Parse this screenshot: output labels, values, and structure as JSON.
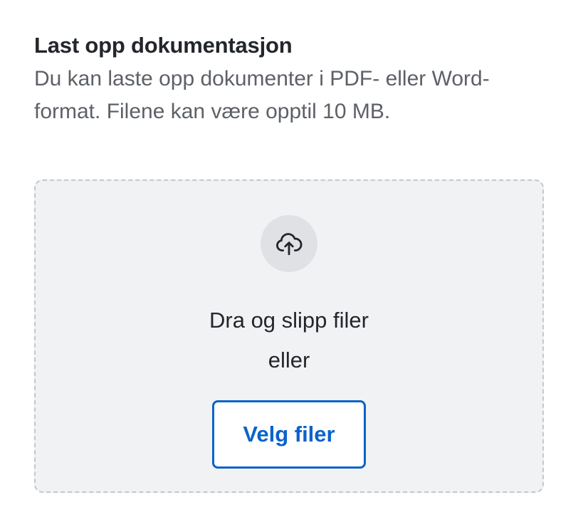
{
  "upload": {
    "title": "Last opp dokumentasjon",
    "description": "Du kan laste opp dokumenter i PDF- eller Word-format. Filene kan være opptil 10 MB.",
    "dropzone": {
      "icon": "cloud-upload-icon",
      "drag_text": "Dra og slipp filer",
      "or_text": "eller",
      "button_label": "Velg filer"
    }
  },
  "colors": {
    "accent": "#0a63c9",
    "dropzone_background": "#f1f2f4",
    "dropzone_border": "#c4c7cc",
    "icon_circle": "#dfe1e5",
    "text_primary": "#23262a",
    "text_secondary": "#5d6167"
  }
}
